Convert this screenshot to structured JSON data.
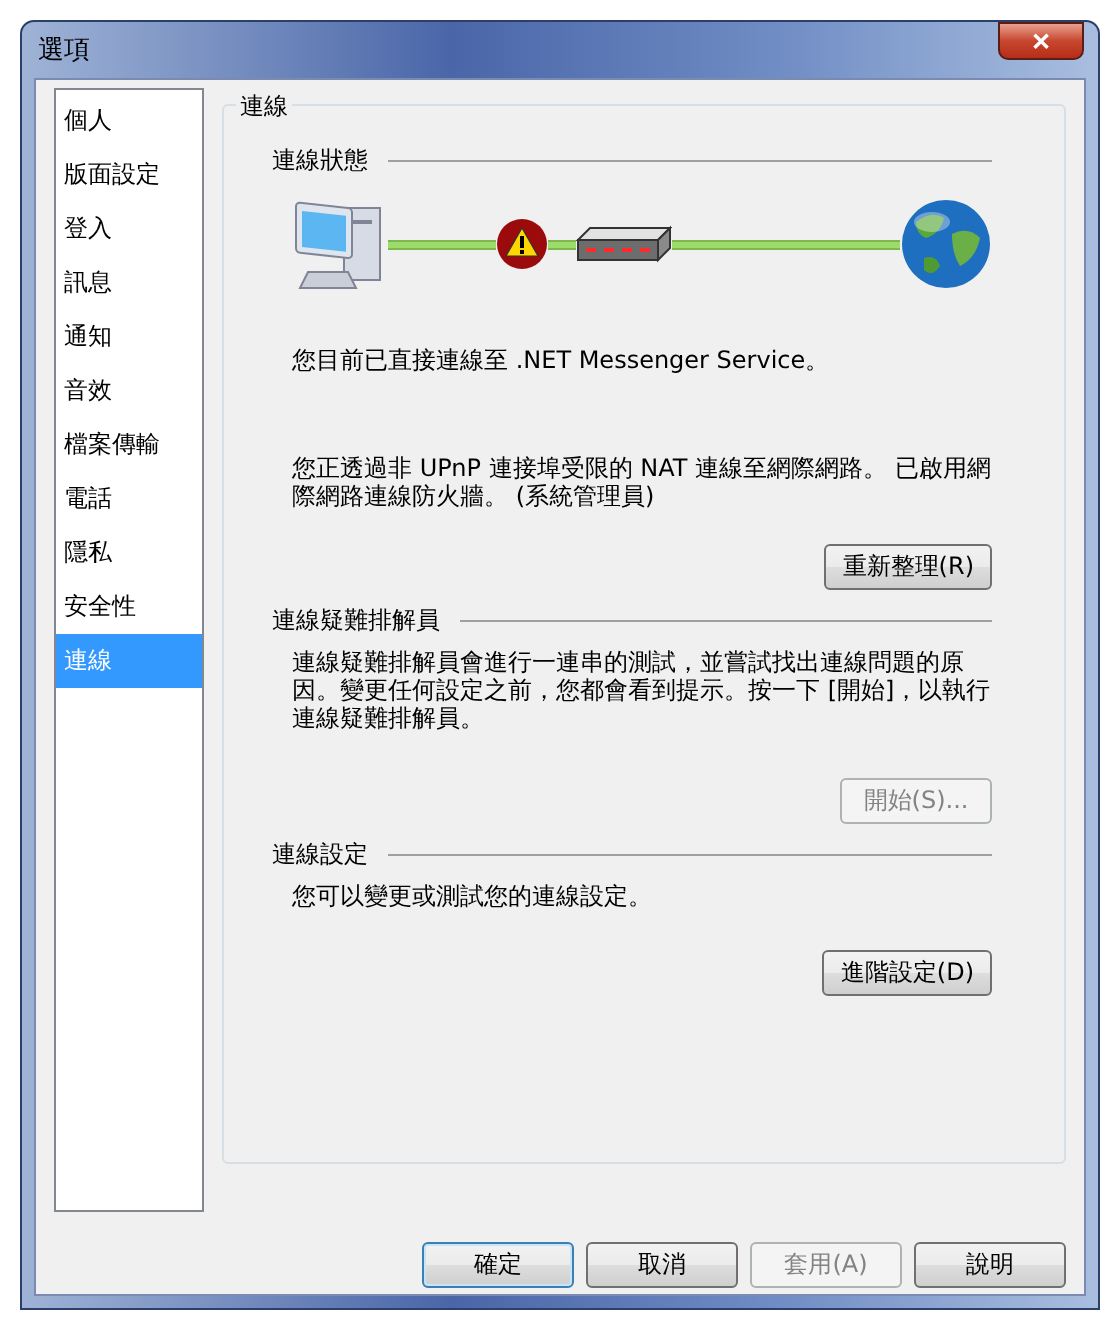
{
  "window": {
    "title": "選項",
    "close": "✕"
  },
  "sidebar": {
    "items": [
      {
        "label": "個人",
        "selected": false
      },
      {
        "label": "版面設定",
        "selected": false
      },
      {
        "label": "登入",
        "selected": false
      },
      {
        "label": "訊息",
        "selected": false
      },
      {
        "label": "通知",
        "selected": false
      },
      {
        "label": "音效",
        "selected": false
      },
      {
        "label": "檔案傳輸",
        "selected": false
      },
      {
        "label": "電話",
        "selected": false
      },
      {
        "label": "隱私",
        "selected": false
      },
      {
        "label": "安全性",
        "selected": false
      },
      {
        "label": "連線",
        "selected": true
      }
    ]
  },
  "panel": {
    "title": "連線",
    "sections": [
      {
        "heading": "連線狀態",
        "kind": "status",
        "texts": [
          "您目前已直接連線至 .NET Messenger Service。",
          "您正透過非 UPnP 連接埠受限的 NAT 連線至網際網路。 已啟用網際網路連線防火牆。 (系統管理員)"
        ],
        "button": {
          "label": "重新整理(R)",
          "disabled": false
        }
      },
      {
        "heading": "連線疑難排解員",
        "kind": "text",
        "texts": [
          "連線疑難排解員會進行一連串的測試，並嘗試找出連線問題的原因。變更任何設定之前，您都會看到提示。按一下 [開始]，以執行連線疑難排解員。"
        ],
        "button": {
          "label": "開始(S)...",
          "disabled": true
        }
      },
      {
        "heading": "連線設定",
        "kind": "text",
        "texts": [
          "您可以變更或測試您的連線設定。"
        ],
        "button": {
          "label": "進階設定(D)",
          "disabled": false
        }
      }
    ]
  },
  "buttons": [
    {
      "label": "確定",
      "disabled": false,
      "default": true
    },
    {
      "label": "取消",
      "disabled": false,
      "default": false
    },
    {
      "label": "套用(A)",
      "disabled": true,
      "default": false
    },
    {
      "label": "說明",
      "disabled": false,
      "default": false
    }
  ]
}
